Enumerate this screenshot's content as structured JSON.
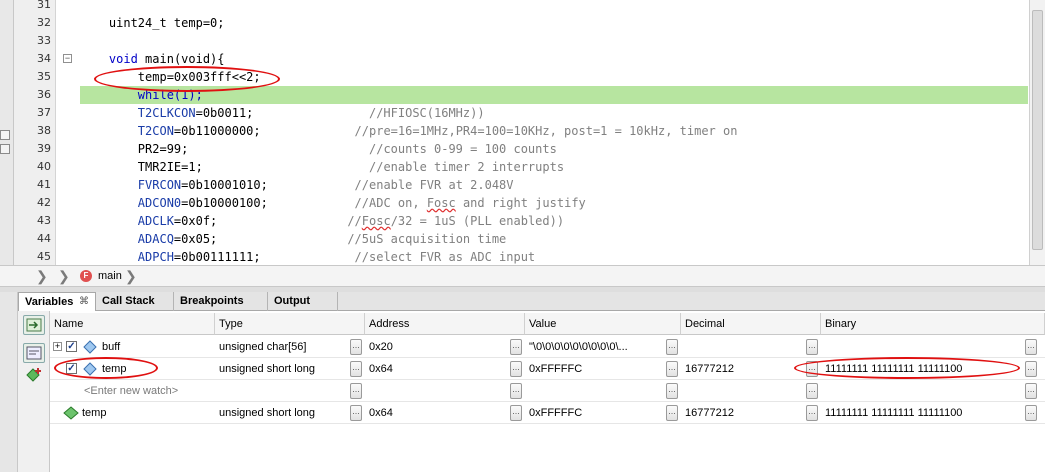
{
  "editor": {
    "lines": [
      {
        "num": "31",
        "code": []
      },
      {
        "num": "32",
        "code": [
          {
            "t": "    uint24_t temp=0;",
            "c": ""
          }
        ]
      },
      {
        "num": "33",
        "code": []
      },
      {
        "num": "34",
        "code": [
          {
            "t": "    void ",
            "c": "kw"
          },
          {
            "t": "main",
            "c": ""
          },
          {
            "t": "(void){",
            "c": ""
          }
        ]
      },
      {
        "num": "35",
        "code": [
          {
            "t": "        temp=0x003fff<<2;",
            "c": ""
          }
        ]
      },
      {
        "num": "36",
        "code": [
          {
            "t": "        while(1);",
            "c": "kw"
          }
        ]
      },
      {
        "num": "37",
        "code": [
          {
            "t": "        T2CLKCON",
            "c": "field"
          },
          {
            "t": "=0b0011;",
            "c": ""
          },
          {
            "t": "                //HFIOSC(16MHz))",
            "c": "com"
          }
        ]
      },
      {
        "num": "38",
        "code": [
          {
            "t": "        T2CON",
            "c": "field"
          },
          {
            "t": "=0b11000000;",
            "c": ""
          },
          {
            "t": "             //pre=16=1MHz,PR4=100=10KHz, post=1 = 10kHz, timer on",
            "c": "com"
          }
        ]
      },
      {
        "num": "39",
        "code": [
          {
            "t": "        PR2=99;",
            "c": ""
          },
          {
            "t": "                         //counts 0-99 = 100 counts",
            "c": "com"
          }
        ]
      },
      {
        "num": "40",
        "code": [
          {
            "t": "        TMR2IE=1;",
            "c": ""
          },
          {
            "t": "                       //enable timer 2 interrupts",
            "c": "com"
          }
        ]
      },
      {
        "num": "41",
        "code": [
          {
            "t": "        FVRCON",
            "c": "field"
          },
          {
            "t": "=0b10001010;",
            "c": ""
          },
          {
            "t": "            //enable FVR at 2.048V",
            "c": "com"
          }
        ]
      },
      {
        "num": "42",
        "code": [
          {
            "t": "        ADCON0",
            "c": "field"
          },
          {
            "t": "=0b10000100;",
            "c": ""
          },
          {
            "t": "            //ADC on, ",
            "c": "com"
          },
          {
            "t": "Fosc",
            "c": "squig"
          },
          {
            "t": " and right justify",
            "c": "com"
          }
        ]
      },
      {
        "num": "43",
        "code": [
          {
            "t": "        ADCLK",
            "c": "field"
          },
          {
            "t": "=0x0f;",
            "c": ""
          },
          {
            "t": "                  //",
            "c": "com"
          },
          {
            "t": "Fosc",
            "c": "squig"
          },
          {
            "t": "/32 = 1uS (PLL enabled))",
            "c": "com"
          }
        ]
      },
      {
        "num": "44",
        "code": [
          {
            "t": "        ADACQ",
            "c": "field"
          },
          {
            "t": "=0x05;",
            "c": ""
          },
          {
            "t": "                  //5uS acquisition time",
            "c": "com"
          }
        ]
      },
      {
        "num": "45",
        "code": [
          {
            "t": "        ADPCH",
            "c": "field"
          },
          {
            "t": "=0b00111111;",
            "c": ""
          },
          {
            "t": "             //select FVR as ADC input",
            "c": "com"
          }
        ]
      }
    ],
    "current_line": "36"
  },
  "breadcrumb": {
    "func": "main"
  },
  "tabs": [
    {
      "label": "Variables",
      "active": true
    },
    {
      "label": "Call Stack",
      "active": false
    },
    {
      "label": "Breakpoints",
      "active": false
    },
    {
      "label": "Output",
      "active": false
    }
  ],
  "variables": {
    "columns": [
      "Name",
      "Type",
      "Address",
      "Value",
      "Decimal",
      "Binary"
    ],
    "rows": [
      {
        "name": "buff",
        "type": "unsigned char[56]",
        "address": "0x20",
        "value": "\"\\0\\0\\0\\0\\0\\0\\0\\0\\0\\...",
        "decimal": "",
        "binary": "",
        "expand": true,
        "checked": true,
        "icon": "watch-icon"
      },
      {
        "name": "temp",
        "type": "unsigned short long",
        "address": "0x64",
        "value": "0xFFFFFC",
        "decimal": "16777212",
        "binary": "11111111 11111111 11111100",
        "expand": false,
        "checked": true,
        "icon": "watch-icon"
      },
      {
        "name": "<Enter new watch>",
        "type": "",
        "address": "",
        "value": "",
        "decimal": "",
        "binary": "",
        "expand": false,
        "checked": false,
        "icon": ""
      },
      {
        "name": "temp",
        "type": "unsigned short long",
        "address": "0x64",
        "value": "0xFFFFFC",
        "decimal": "16777212",
        "binary": "11111111 11111111 11111100",
        "expand": false,
        "checked": false,
        "icon": "variable-icon"
      }
    ]
  },
  "colors": {
    "current_line": "#b7e5a0",
    "annotation": "#e01010",
    "keyword": "#0000c8",
    "comment": "#808080"
  }
}
